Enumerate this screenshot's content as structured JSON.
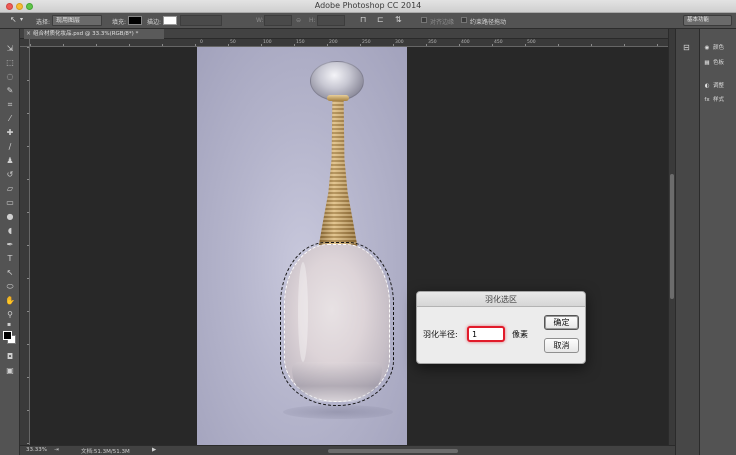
{
  "window": {
    "title": "Adobe Photoshop CC 2014"
  },
  "options_bar": {
    "select_label": "选择:",
    "select_value": "现用图层",
    "fill_label": "填充:",
    "stroke_label": "描边:",
    "w_label": "W:",
    "h_label": "H:",
    "align_edges_label": "对齐边缘",
    "constrain_path_label": "约束路径拖动",
    "workspace": "基本功能"
  },
  "document": {
    "tab_title": "组合材质化妆品.psd @ 33.3%(RGB/8*) *",
    "close_glyph": "×"
  },
  "ruler": {
    "labels": [
      "0",
      "50",
      "100",
      "150",
      "200",
      "250",
      "300",
      "350",
      "400",
      "450",
      "500"
    ]
  },
  "panels": {
    "items": [
      {
        "label": "颜色",
        "icon": "color-wheel-icon",
        "glyph": "◉"
      },
      {
        "label": "色板",
        "icon": "swatches-icon",
        "glyph": "▦"
      },
      {
        "label": "调整",
        "icon": "adjustments-icon",
        "glyph": "◐"
      },
      {
        "label": "样式",
        "icon": "styles-icon",
        "glyph": "fx"
      }
    ]
  },
  "status": {
    "zoom": "33.33%",
    "doc_size": "文档:51.3M/51.3M",
    "arrow": "▶"
  },
  "dialog": {
    "title": "羽化选区",
    "radius_label": "羽化半径:",
    "radius_value": "1",
    "unit": "像素",
    "ok_label": "确定",
    "cancel_label": "取消"
  },
  "colors": {
    "foreground": "#000000",
    "background": "#ffffff",
    "focus_ring": "#e11b2a"
  }
}
